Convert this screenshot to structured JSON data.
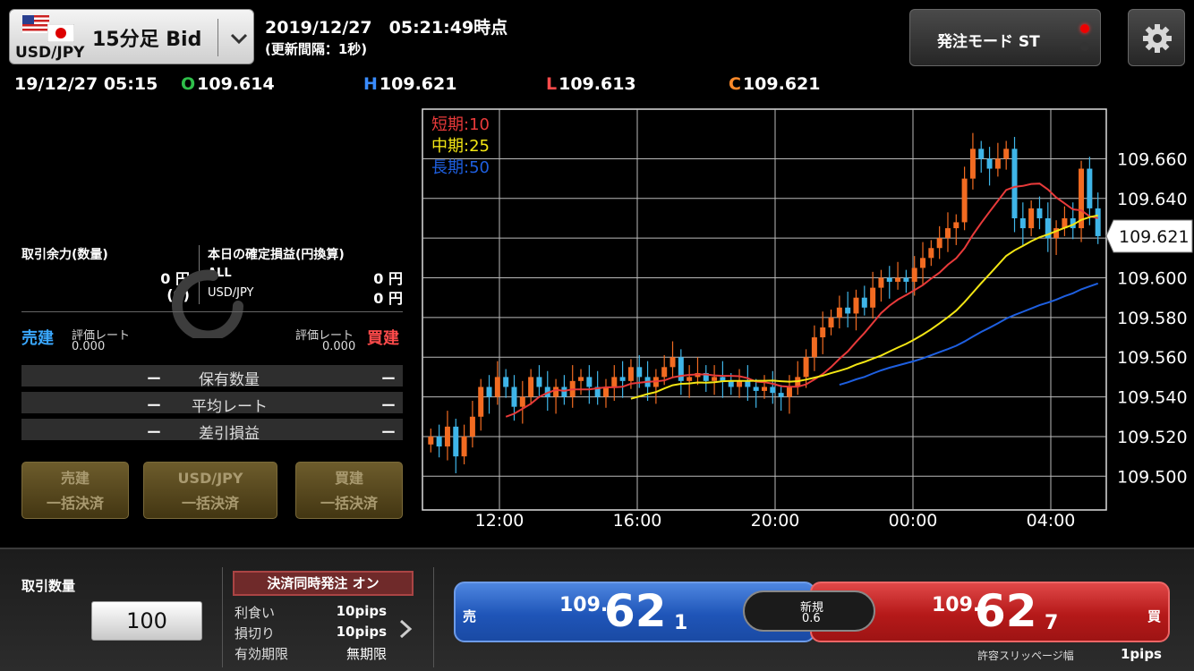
{
  "header": {
    "pair_symbol": "USD/JPY",
    "pair_label": "15分足 Bid",
    "datetime": "2019/12/27　05:21:49時点",
    "interval": "(更新間隔：1秒)",
    "order_mode": "発注モード ST"
  },
  "ohlc": {
    "time": "19/12/27 05:15",
    "o_key": "O",
    "o": "109.614",
    "h_key": "H",
    "h": "109.621",
    "l_key": "L",
    "l": "109.613",
    "c_key": "C",
    "c": "109.621"
  },
  "account": {
    "margin_label": "取引余力(数量)",
    "margin_amount": "0 円",
    "margin_qty": "(0)",
    "pnl_label": "本日の確定損益(円換算)",
    "all_label": "ALL",
    "all_value": "0 円",
    "pair_label": "USD/JPY",
    "pair_value": "0 円"
  },
  "positions": {
    "sell_label": "売建",
    "sell_rate_label": "評価レート",
    "sell_rate": "0.000",
    "buy_label": "買建",
    "buy_rate_label": "評価レート",
    "buy_rate": "0.000",
    "dash": "ー",
    "rows": [
      "保有数量",
      "平均レート",
      "差引損益"
    ]
  },
  "settle_buttons": [
    {
      "line1": "売建",
      "line2": "一括決済"
    },
    {
      "line1": "USD/JPY",
      "line2": "一括決済"
    },
    {
      "line1": "買建",
      "line2": "一括決済"
    }
  ],
  "bottom": {
    "qty_label": "取引数量",
    "qty_value": "100",
    "simul_label": "決済同時発注 オン",
    "options": [
      {
        "label": "利食い",
        "value": "10pips"
      },
      {
        "label": "損切り",
        "value": "10pips"
      },
      {
        "label": "有効期限",
        "value": "無期限"
      }
    ],
    "sell": {
      "side": "売",
      "prefix": "109.",
      "big": "62",
      "tail": "1"
    },
    "buy": {
      "side": "買",
      "prefix": "109.",
      "big": "62",
      "tail": "7"
    },
    "spread_label": "新規",
    "spread_value": "0.6",
    "slippage_label": "許容スリッページ幅",
    "slippage_value": "1pips"
  },
  "colors": {
    "short_ma": "#e83a3a",
    "mid_ma": "#f3e614",
    "long_ma": "#1e5fe0",
    "up": "#f26b21",
    "down": "#3fb5e8"
  },
  "chart_data": {
    "type": "candlestick",
    "legend": [
      {
        "name": "短期:10",
        "color": "#e83a3a"
      },
      {
        "name": "中期:25",
        "color": "#f3e614"
      },
      {
        "name": "長期:50",
        "color": "#1e5fe0"
      }
    ],
    "x_ticks": [
      "12:00",
      "16:00",
      "20:00",
      "00:00",
      "04:00"
    ],
    "y_ticks": [
      109.66,
      109.64,
      109.62,
      109.6,
      109.58,
      109.56,
      109.54,
      109.52,
      109.5
    ],
    "y_tick_labels": [
      "109.660",
      "109.640",
      "109.620",
      "109.600",
      "109.580",
      "109.560",
      "109.540",
      "109.520",
      "109.500"
    ],
    "ylim": [
      109.483,
      109.685
    ],
    "current_price": 109.621,
    "current_price_label": "109.621",
    "candles_count": 81,
    "closes": [
      109.52,
      109.515,
      109.525,
      109.51,
      109.52,
      109.53,
      109.545,
      109.54,
      109.55,
      109.545,
      109.535,
      109.54,
      109.55,
      109.545,
      109.54,
      109.545,
      109.54,
      109.548,
      109.55,
      109.545,
      109.54,
      109.545,
      109.55,
      109.548,
      109.555,
      109.55,
      109.545,
      109.55,
      109.555,
      109.56,
      109.548,
      109.55,
      109.552,
      109.548,
      109.55,
      109.548,
      109.545,
      109.548,
      109.545,
      109.543,
      109.545,
      109.542,
      109.54,
      109.545,
      109.55,
      109.56,
      109.57,
      109.575,
      109.58,
      109.585,
      109.582,
      109.59,
      109.585,
      109.595,
      109.6,
      109.598,
      109.6,
      109.598,
      109.605,
      109.61,
      109.615,
      109.62,
      109.625,
      109.628,
      109.65,
      109.665,
      109.66,
      109.655,
      109.66,
      109.665,
      109.63,
      109.625,
      109.635,
      109.63,
      109.62,
      109.625,
      109.63,
      109.625,
      109.655,
      109.635,
      109.621
    ]
  }
}
